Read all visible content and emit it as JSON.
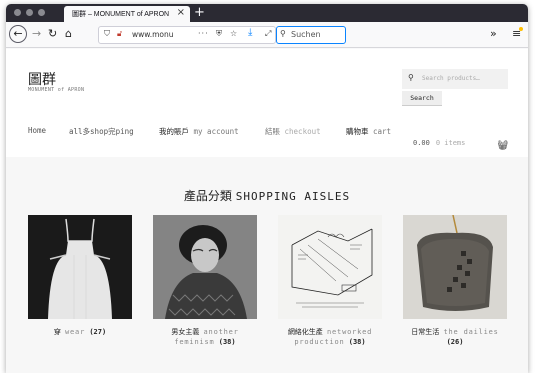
{
  "browser": {
    "tab_title": "圖群 – MONUMENT of APRON",
    "url": "www.monu",
    "search_placeholder": "Suchen",
    "new_tab": "+",
    "tab_close": "×"
  },
  "site": {
    "title": "圖群",
    "subtitle": "MONUMENT of APRON",
    "search_placeholder": "Search products…",
    "search_button": "Search"
  },
  "menu": {
    "home": "Home",
    "all_shopping": "all多shop完ping",
    "account_zh": "我的賬戶",
    "account_en": "my account",
    "checkout_zh": "結賬",
    "checkout_en": "checkout",
    "cart_zh": "購物車",
    "cart_en": "cart"
  },
  "cart": {
    "total": "0.00",
    "items": "0 items"
  },
  "section": {
    "title_zh": "產品分類",
    "title_en": "SHOPPING AISLES"
  },
  "products": [
    {
      "zh": "穿",
      "en": "wear",
      "count": "(27)"
    },
    {
      "zh": "男女主義",
      "en": "another feminism",
      "count": "(38)"
    },
    {
      "zh": "網絡化生產",
      "en": "networked production",
      "count": "(38)"
    },
    {
      "zh": "日常生活",
      "en": "the dailies",
      "count": "(26)"
    }
  ]
}
